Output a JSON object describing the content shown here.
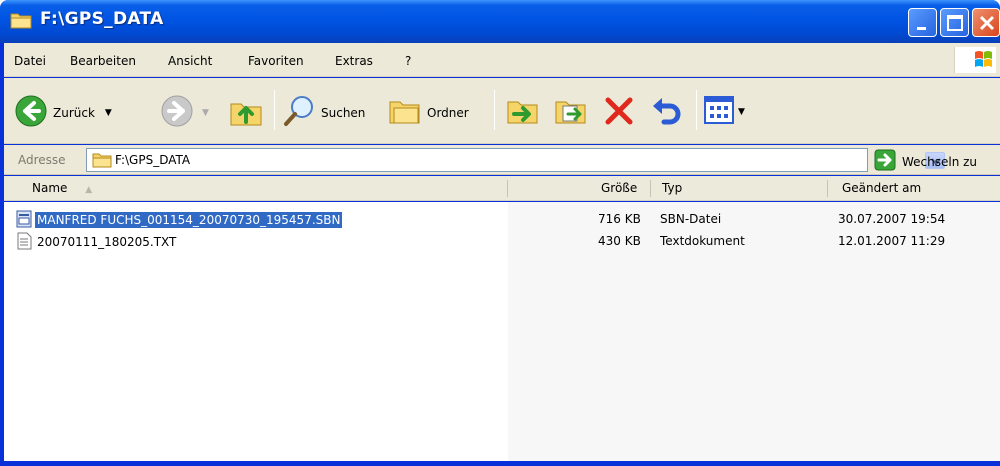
{
  "window": {
    "title": "F:\\GPS_DATA"
  },
  "menu": [
    {
      "label": "Datei"
    },
    {
      "label": "Bearbeiten"
    },
    {
      "label": "Ansicht"
    },
    {
      "label": "Favoriten"
    },
    {
      "label": "Extras"
    },
    {
      "label": "?"
    }
  ],
  "toolbar": {
    "back_label": "Zurück",
    "search_label": "Suchen",
    "folders_label": "Ordner"
  },
  "address": {
    "label": "Adresse",
    "value": "F:\\GPS_DATA",
    "go_label": "Wechseln zu"
  },
  "columns": {
    "name": "Name",
    "size": "Größe",
    "type": "Typ",
    "modified": "Geändert am"
  },
  "files": [
    {
      "name": "MANFRED FUCHS_001154_20070730_195457.SBN",
      "size": "716 KB",
      "type": "SBN-Datei",
      "modified": "30.07.2007 19:54",
      "icon": "sbn-file-icon",
      "selected": true
    },
    {
      "name": "20070111_180205.TXT",
      "size": "430 KB",
      "type": "Textdokument",
      "modified": "12.01.2007 11:29",
      "icon": "text-file-icon",
      "selected": false
    }
  ],
  "colors": {
    "titlebar": "#0054e3",
    "selection": "#316ac5",
    "chrome": "#ece9d8"
  }
}
